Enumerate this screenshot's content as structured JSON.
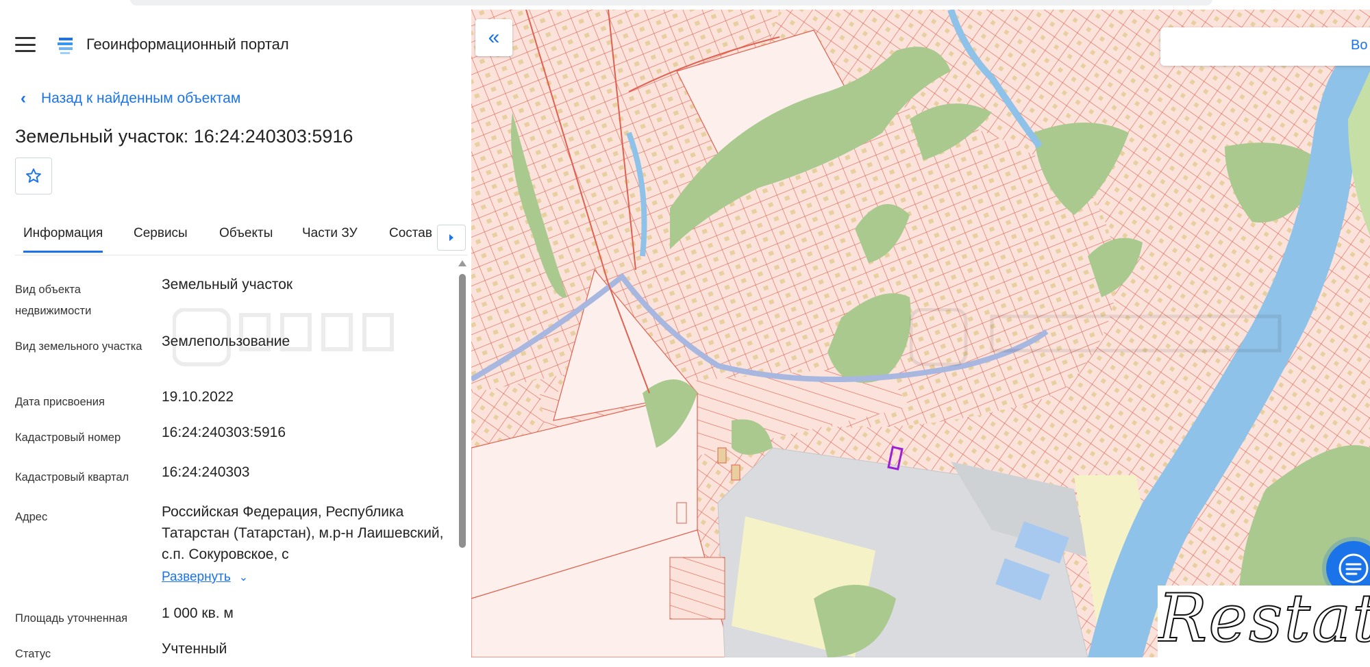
{
  "header": {
    "menu_icon": "hamburger-icon",
    "logo_icon": "portal-logo-icon",
    "title": "Геоинформационный портал"
  },
  "back_link": {
    "icon": "chevron-left-icon",
    "label": "Назад к найденным объектам"
  },
  "object": {
    "title": "Земельный участок: 16:24:240303:5916",
    "favorite_icon": "star-outline-icon"
  },
  "tabs": [
    {
      "label": "Информация",
      "active": true
    },
    {
      "label": "Сервисы",
      "active": false
    },
    {
      "label": "Объекты",
      "active": false
    },
    {
      "label": "Части ЗУ",
      "active": false
    },
    {
      "label": "Состав",
      "active": false
    }
  ],
  "tabs_next_icon": "caret-right-icon",
  "info": {
    "rows": [
      {
        "label": "Вид объекта недвижимости",
        "value": "Земельный участок"
      },
      {
        "label": "Вид земельного участка",
        "value": "Землепользование"
      },
      {
        "label": "Дата присвоения",
        "value": "19.10.2022"
      },
      {
        "label": "Кадастровый номер",
        "value": "16:24:240303:5916"
      },
      {
        "label": "Кадастровый квартал",
        "value": "16:24:240303"
      },
      {
        "label": "Адрес",
        "value": "Российская Федерация, Республика Татарстан (Татарстан), м.р-н Лаишевский, с.п. Сокуровское, с"
      },
      {
        "label": "Площадь уточненная",
        "value": "1 000 кв. м"
      },
      {
        "label": "Статус",
        "value": "Учтенный"
      }
    ],
    "expand_label": "Развернуть"
  },
  "map": {
    "collapse_icon": "double-chevron-left-icon",
    "search_text": "Во",
    "chat_icon": "chat-icon",
    "watermark": "Restate",
    "colors": {
      "parcel_fill": "#fbe3dc",
      "parcel_line": "#e0604f",
      "forest": "#a9c98f",
      "river": "#8fc2e8",
      "industrial": "#d9dbde",
      "field": "#f5f2c8",
      "selected_parcel": "#9b1fd6"
    }
  },
  "colors": {
    "accent": "#1a73e8"
  }
}
